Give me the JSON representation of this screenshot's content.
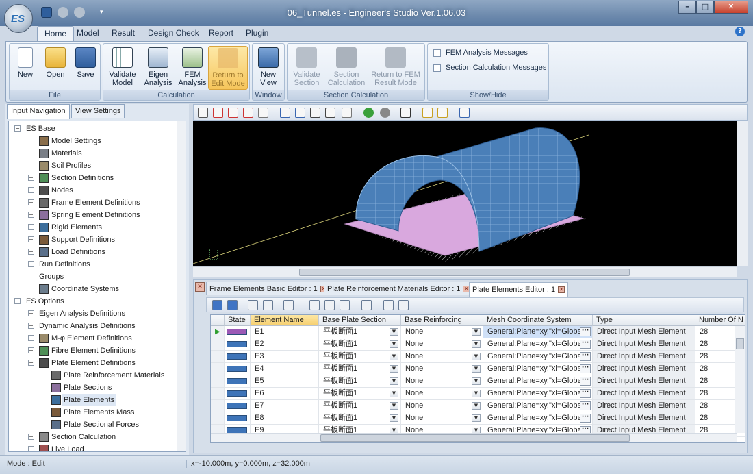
{
  "window": {
    "title": "06_Tunnel.es - Engineer's Studio Ver.1.06.03",
    "logo_text": "ES"
  },
  "quick_access": {
    "icons": [
      "save-icon",
      "undo-icon",
      "redo-icon",
      "customize-icon"
    ]
  },
  "ribbon_tabs": [
    "Home",
    "Model",
    "Result",
    "Design Check",
    "Report",
    "Plugin"
  ],
  "ribbon": {
    "file": {
      "label": "File",
      "new": "New",
      "open": "Open",
      "save": "Save"
    },
    "calculation": {
      "label": "Calculation",
      "validate": "Validate\nModel",
      "eigen": "Eigen\nAnalysis",
      "fem": "FEM\nAnalysis",
      "return": "Return to\nEdit Mode"
    },
    "window": {
      "label": "Window",
      "new_view": "New\nView"
    },
    "section_calc": {
      "label": "Section Calculation",
      "validate": "Validate\nSection",
      "section": "Section\nCalculation",
      "return": "Return to FEM\nResult Mode"
    },
    "showhide": {
      "label": "Show/Hide",
      "fem_msgs": "FEM Analysis Messages",
      "section_msgs": "Section Calculation Messages"
    }
  },
  "left_panel": {
    "tabs": [
      "Input Navigation",
      "View Settings"
    ],
    "tree": [
      {
        "label": "ES Base",
        "exp": "−",
        "icon": "",
        "level": 0
      },
      {
        "label": "Model Settings",
        "exp": "",
        "icon": "model-settings-icon",
        "level": 1
      },
      {
        "label": "Materials",
        "exp": "",
        "icon": "materials-icon",
        "level": 1
      },
      {
        "label": "Soil Profiles",
        "exp": "",
        "icon": "soil-profiles-icon",
        "level": 1
      },
      {
        "label": "Section Definitions",
        "exp": "+",
        "icon": "section-definitions-icon",
        "level": 1
      },
      {
        "label": "Nodes",
        "exp": "+",
        "icon": "nodes-icon",
        "level": 1
      },
      {
        "label": "Frame Element Definitions",
        "exp": "+",
        "icon": "frame-element-icon",
        "level": 1
      },
      {
        "label": "Spring Element Definitions",
        "exp": "+",
        "icon": "spring-element-icon",
        "level": 1
      },
      {
        "label": "Rigid Elements",
        "exp": "+",
        "icon": "rigid-elements-icon",
        "level": 1
      },
      {
        "label": "Support Definitions",
        "exp": "+",
        "icon": "support-icon",
        "level": 1
      },
      {
        "label": "Load Definitions",
        "exp": "+",
        "icon": "load-icon",
        "level": 1
      },
      {
        "label": "Run Definitions",
        "exp": "+",
        "icon": "",
        "level": 1
      },
      {
        "label": "Groups",
        "exp": "",
        "icon": "",
        "level": 1
      },
      {
        "label": "Coordinate Systems",
        "exp": "",
        "icon": "coordinate-systems-icon",
        "level": 1
      },
      {
        "label": "ES Options",
        "exp": "−",
        "icon": "",
        "level": 0
      },
      {
        "label": "Eigen Analysis Definitions",
        "exp": "+",
        "icon": "",
        "level": 1
      },
      {
        "label": "Dynamic Analysis Definitions",
        "exp": "+",
        "icon": "",
        "level": 1
      },
      {
        "label": "M-φ Element Definitions",
        "exp": "+",
        "icon": "m-phi-element-icon",
        "level": 1
      },
      {
        "label": "Fibre Element Definitions",
        "exp": "+",
        "icon": "fibre-element-icon",
        "level": 1
      },
      {
        "label": "Plate Element Definitions",
        "exp": "−",
        "icon": "plate-element-icon",
        "level": 1
      },
      {
        "label": "Plate Reinforcement Materials",
        "exp": "",
        "icon": "plate-reinforcement-icon",
        "level": 2
      },
      {
        "label": "Plate Sections",
        "exp": "",
        "icon": "plate-sections-icon",
        "level": 2
      },
      {
        "label": "Plate Elements",
        "exp": "",
        "icon": "plate-elements-icon",
        "level": 2,
        "selected": true
      },
      {
        "label": "Plate Elements Mass",
        "exp": "",
        "icon": "plate-elements-mass-icon",
        "level": 2
      },
      {
        "label": "Plate Sectional Forces",
        "exp": "",
        "icon": "plate-sectional-forces-icon",
        "level": 2
      },
      {
        "label": "Section Calculation",
        "exp": "+",
        "icon": "section-calculation-icon",
        "level": 1
      },
      {
        "label": "Live Load",
        "exp": "+",
        "icon": "live-load-icon",
        "level": 1
      }
    ]
  },
  "editor": {
    "tabs": [
      "Frame Elements Basic Editor : 1",
      "Plate Reinforcement Materials Editor : 1",
      "Plate Elements Editor : 1"
    ],
    "columns": [
      "State",
      "Element Name",
      "Base Plate Section",
      "Base Reinforcing",
      "Mesh Coordinate System",
      "Type",
      "Number Of N"
    ],
    "rows": [
      {
        "name": "E1",
        "section": "平板断面1",
        "reinf": "None",
        "mesh": "General:Plane=xy,\"xl=Globa",
        "type": "Direct Input Mesh Element",
        "num": "28"
      },
      {
        "name": "E2",
        "section": "平板断面1",
        "reinf": "None",
        "mesh": "General:Plane=xy,\"xl=Globa",
        "type": "Direct Input Mesh Element",
        "num": "28"
      },
      {
        "name": "E3",
        "section": "平板断面1",
        "reinf": "None",
        "mesh": "General:Plane=xy,\"xl=Globa",
        "type": "Direct Input Mesh Element",
        "num": "28"
      },
      {
        "name": "E4",
        "section": "平板断面1",
        "reinf": "None",
        "mesh": "General:Plane=xy,\"xl=Globa",
        "type": "Direct Input Mesh Element",
        "num": "28"
      },
      {
        "name": "E5",
        "section": "平板断面1",
        "reinf": "None",
        "mesh": "General:Plane=xy,\"xl=Globa",
        "type": "Direct Input Mesh Element",
        "num": "28"
      },
      {
        "name": "E6",
        "section": "平板断面1",
        "reinf": "None",
        "mesh": "General:Plane=xy,\"xl=Globa",
        "type": "Direct Input Mesh Element",
        "num": "28"
      },
      {
        "name": "E7",
        "section": "平板断面1",
        "reinf": "None",
        "mesh": "General:Plane=xy,\"xl=Globa",
        "type": "Direct Input Mesh Element",
        "num": "28"
      },
      {
        "name": "E8",
        "section": "平板断面1",
        "reinf": "None",
        "mesh": "General:Plane=xy,\"xl=Globa",
        "type": "Direct Input Mesh Element",
        "num": "28"
      },
      {
        "name": "E9",
        "section": "平板断面1",
        "reinf": "None",
        "mesh": "General:Plane=xy,\"xl=Globa",
        "type": "Direct Input Mesh Element",
        "num": "28"
      }
    ]
  },
  "status": {
    "mode": "Mode : Edit",
    "coords": "x=-10.000m, y=0.000m, z=32.000m"
  },
  "colors": {
    "accent": "#2e73c9",
    "selected_row": "#9b59b6",
    "state_swatch": "#3e74b8",
    "tunnel": "#4a7fb8",
    "base": "#e2b8e4"
  }
}
